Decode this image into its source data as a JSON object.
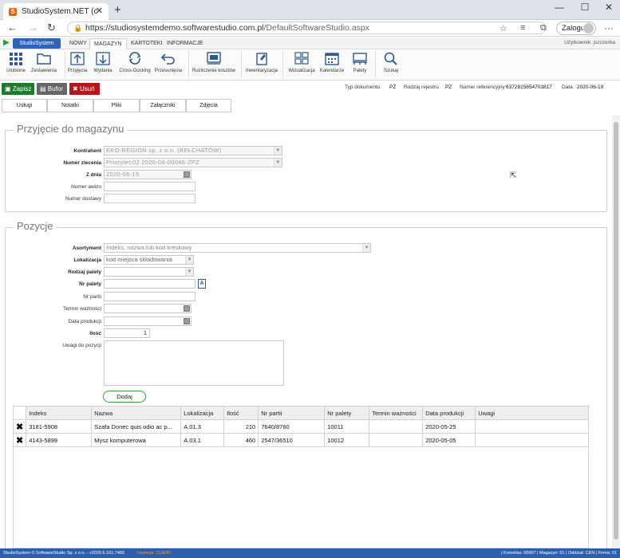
{
  "browser": {
    "tab_title": "StudioSystem.NET (c) SoftwareSt",
    "url_host": "https://studiosystemdemo.softwarestudio.com.pl",
    "url_path": "/DefaultSoftwareStudio.aspx",
    "login_label": "Zaloguj"
  },
  "menubar": {
    "brand": "StudioSystem",
    "items": [
      "NOWY",
      "MAGAZYN",
      "KARTOTEKI",
      "INFORMACJE"
    ],
    "user": "Użytkownik: jszczerba"
  },
  "ribbon": {
    "items": [
      "Ulubione",
      "Zestawienia",
      "Przyjęcia",
      "Wydania",
      "Cross-Docking",
      "Przesunięcia",
      "Rozliczenie kosztów",
      "Inwentaryzacja",
      "Wizualizacja",
      "Kalendarze",
      "Palety",
      "Szukaj"
    ]
  },
  "toolbar": {
    "save": "Zapisz",
    "buffer": "Bufor",
    "delete": "Usuń",
    "doc_type_label": "Typ dokumentu",
    "doc_type": "PZ",
    "register_label": "Rodzaj rejestru",
    "register": "PZ",
    "ref_label": "Numer referencyjny",
    "ref": "6372815654703817",
    "date_label": "Data",
    "date": "2020-06-19"
  },
  "subtabs": [
    "Usługi",
    "Notatki",
    "Pliki",
    "Załączniki",
    "Zdjęcia"
  ],
  "header_section": {
    "title": "Przyjęcie do magazynu",
    "kontrahent_label": "Kontrahent",
    "kontrahent": "EKO-REGION sp. z o.o.  (BEŁCHATÓW)",
    "zlecenie_label": "Numer zlecenia",
    "zlecenie": "Priorytet:02 2020-06-00046-ZPZ",
    "zdnia_label": "Z dnia",
    "zdnia": "2020-06-19",
    "awizo_label": "Numer awizo",
    "dostawy_label": "Numer dostawy"
  },
  "positions": {
    "title": "Pozycje",
    "asortyment_label": "Asortyment",
    "asortyment_placeholder": "Indeks, nazwa lub kod kreskowy",
    "lokalizacja_label": "Lokalizacja",
    "lokalizacja_placeholder": "kod miejsca składowania",
    "rodzaj_label": "Rodzaj palety",
    "nrpalety_label": "Nr palety",
    "nrpartii_label": "Nr partii",
    "termin_label": "Termin ważności",
    "dataprod_label": "Data produkcji",
    "ilosc_label": "Ilość",
    "ilosc": "1",
    "uwagi_label": "Uwagi do pozycji",
    "add_button": "Dodaj"
  },
  "table": {
    "columns": [
      "Indeks",
      "Nazwa",
      "Lokalizacja",
      "Ilość",
      "Nr partii",
      "Nr palety",
      "Termin ważności",
      "Data produkcji",
      "Uwagi"
    ],
    "rows": [
      {
        "indeks": "3181-5908",
        "nazwa": "Szafa Donec quis odio ac p...",
        "lok": "A.01.3",
        "ilosc": "210",
        "partia": "7640/8760",
        "paleta": "10011",
        "termin": "",
        "prod": "2020-05-25",
        "uwagi": ""
      },
      {
        "indeks": "4143-5899",
        "nazwa": "Mysz komputerowa",
        "lok": "A.03.1",
        "ilosc": "460",
        "partia": "2547/36510",
        "paleta": "10012",
        "termin": "",
        "prod": "2020-05-05",
        "uwagi": ""
      }
    ]
  },
  "status": {
    "left": "StudioSystem © SoftwareStudio Sp. z o.o. - v2020.6.161.7465",
    "license": "Licencja: CLIENT",
    "right": "| Komórka: 00007 | Magazyn: 01 | Oddział: CEN | Firma: 01"
  },
  "colors": {
    "brand": "#2f63b8",
    "save": "#1f7a2e",
    "delete": "#b3171b",
    "status": "#2b5fad"
  }
}
